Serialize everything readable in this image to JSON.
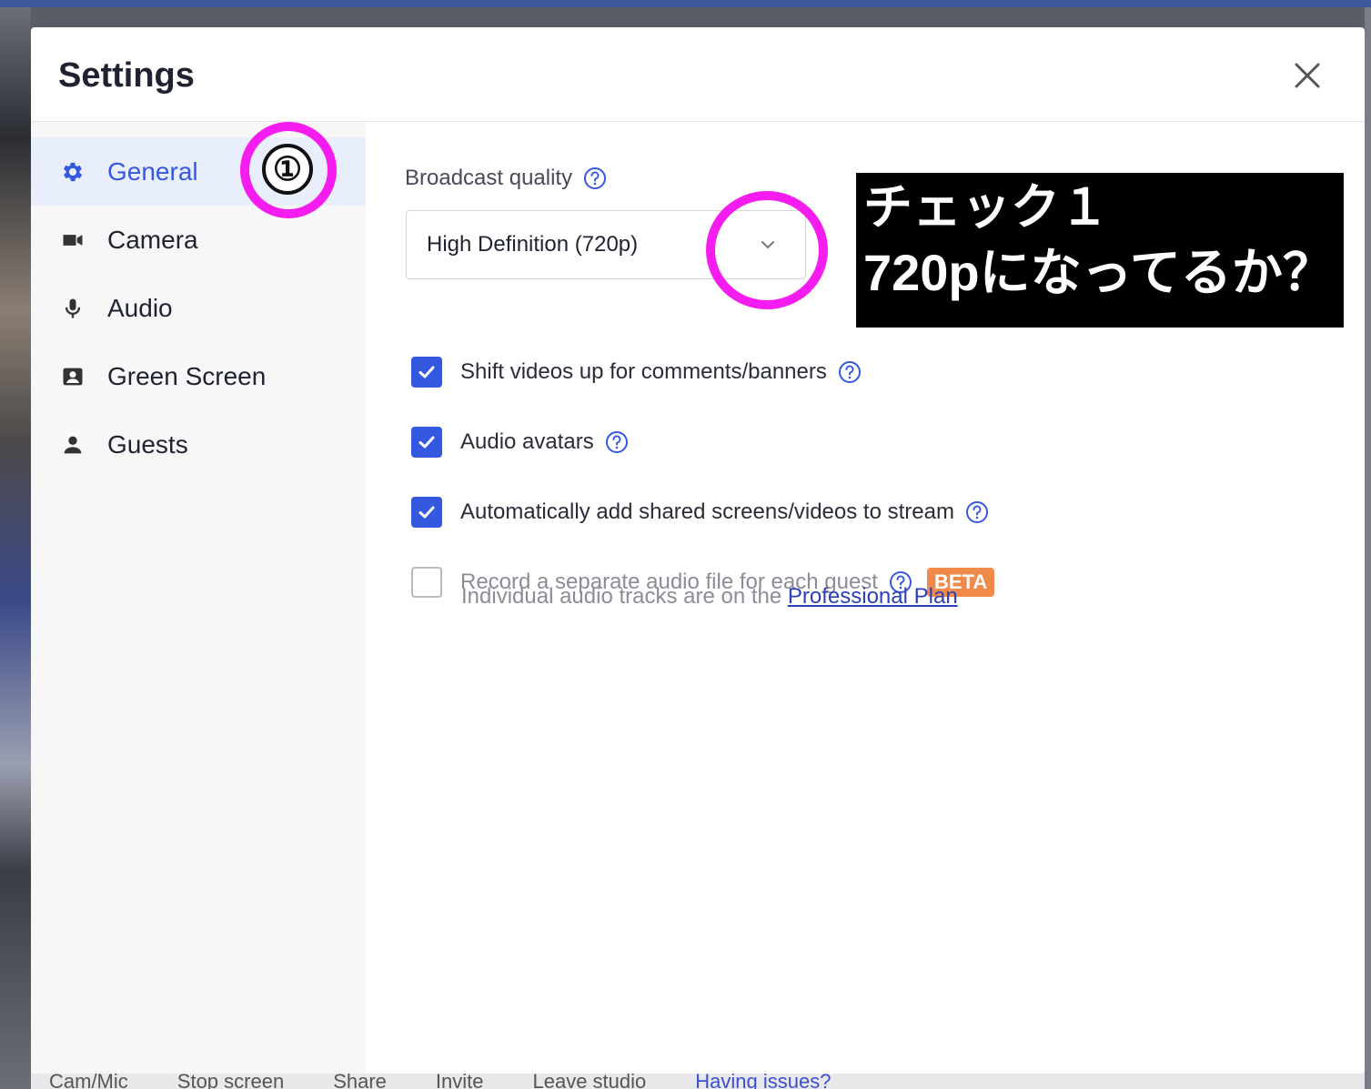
{
  "background": {
    "bottom_bar": [
      "Cam/Mic",
      "Stop screen",
      "Share",
      "Invite",
      "Leave studio",
      "Having issues?"
    ]
  },
  "modal": {
    "title": "Settings",
    "close_icon": "close-icon"
  },
  "sidebar": {
    "items": [
      {
        "label": "General",
        "icon": "gear-icon",
        "active": true
      },
      {
        "label": "Camera",
        "icon": "video-camera-icon",
        "active": false
      },
      {
        "label": "Audio",
        "icon": "microphone-icon",
        "active": false
      },
      {
        "label": "Green Screen",
        "icon": "portrait-icon",
        "active": false
      },
      {
        "label": "Guests",
        "icon": "person-icon",
        "active": false
      }
    ]
  },
  "general": {
    "broadcast_quality_label": "Broadcast quality",
    "broadcast_quality_value": "High Definition (720p)",
    "options": [
      {
        "label": "Shift videos up for comments/banners",
        "checked": true
      },
      {
        "label": "Audio avatars",
        "checked": true
      },
      {
        "label": "Automatically add shared screens/videos to stream",
        "checked": true
      },
      {
        "label": "Record a separate audio file for each guest",
        "checked": false,
        "badge": "BETA"
      }
    ],
    "upgrade_note": "Individual audio tracks are on the",
    "upgrade_link": "Professional Plan"
  },
  "annotations": {
    "step_number": "①",
    "note_line1": "チェック１",
    "note_line2": "720pになってるか？",
    "highlight_color": "#f51cf0"
  },
  "colors": {
    "accent": "#3558e0",
    "beta": "#f08a4b",
    "link": "#2c3fb8"
  }
}
